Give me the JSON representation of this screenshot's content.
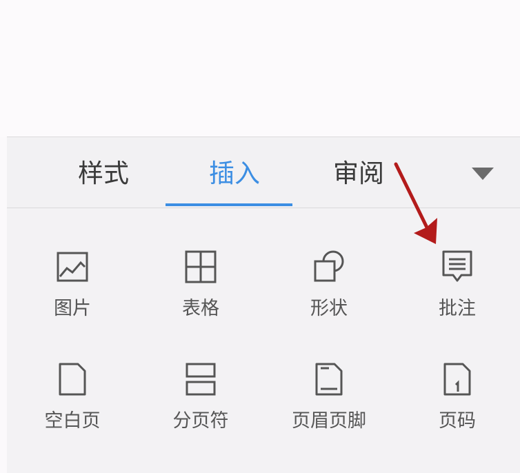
{
  "tabs": [
    {
      "label": "样式",
      "active": false
    },
    {
      "label": "插入",
      "active": true
    },
    {
      "label": "审阅",
      "active": false
    }
  ],
  "tools": [
    {
      "label": "图片",
      "icon": "picture-icon"
    },
    {
      "label": "表格",
      "icon": "table-icon"
    },
    {
      "label": "形状",
      "icon": "shape-icon"
    },
    {
      "label": "批注",
      "icon": "comment-icon"
    },
    {
      "label": "空白页",
      "icon": "blank-page-icon"
    },
    {
      "label": "分页符",
      "icon": "page-break-icon"
    },
    {
      "label": "页眉页脚",
      "icon": "header-footer-icon"
    },
    {
      "label": "页码",
      "icon": "page-number-icon"
    }
  ],
  "colors": {
    "accent": "#3c8ee3",
    "icon": "#555555",
    "annotation_arrow": "#b31b1b"
  }
}
